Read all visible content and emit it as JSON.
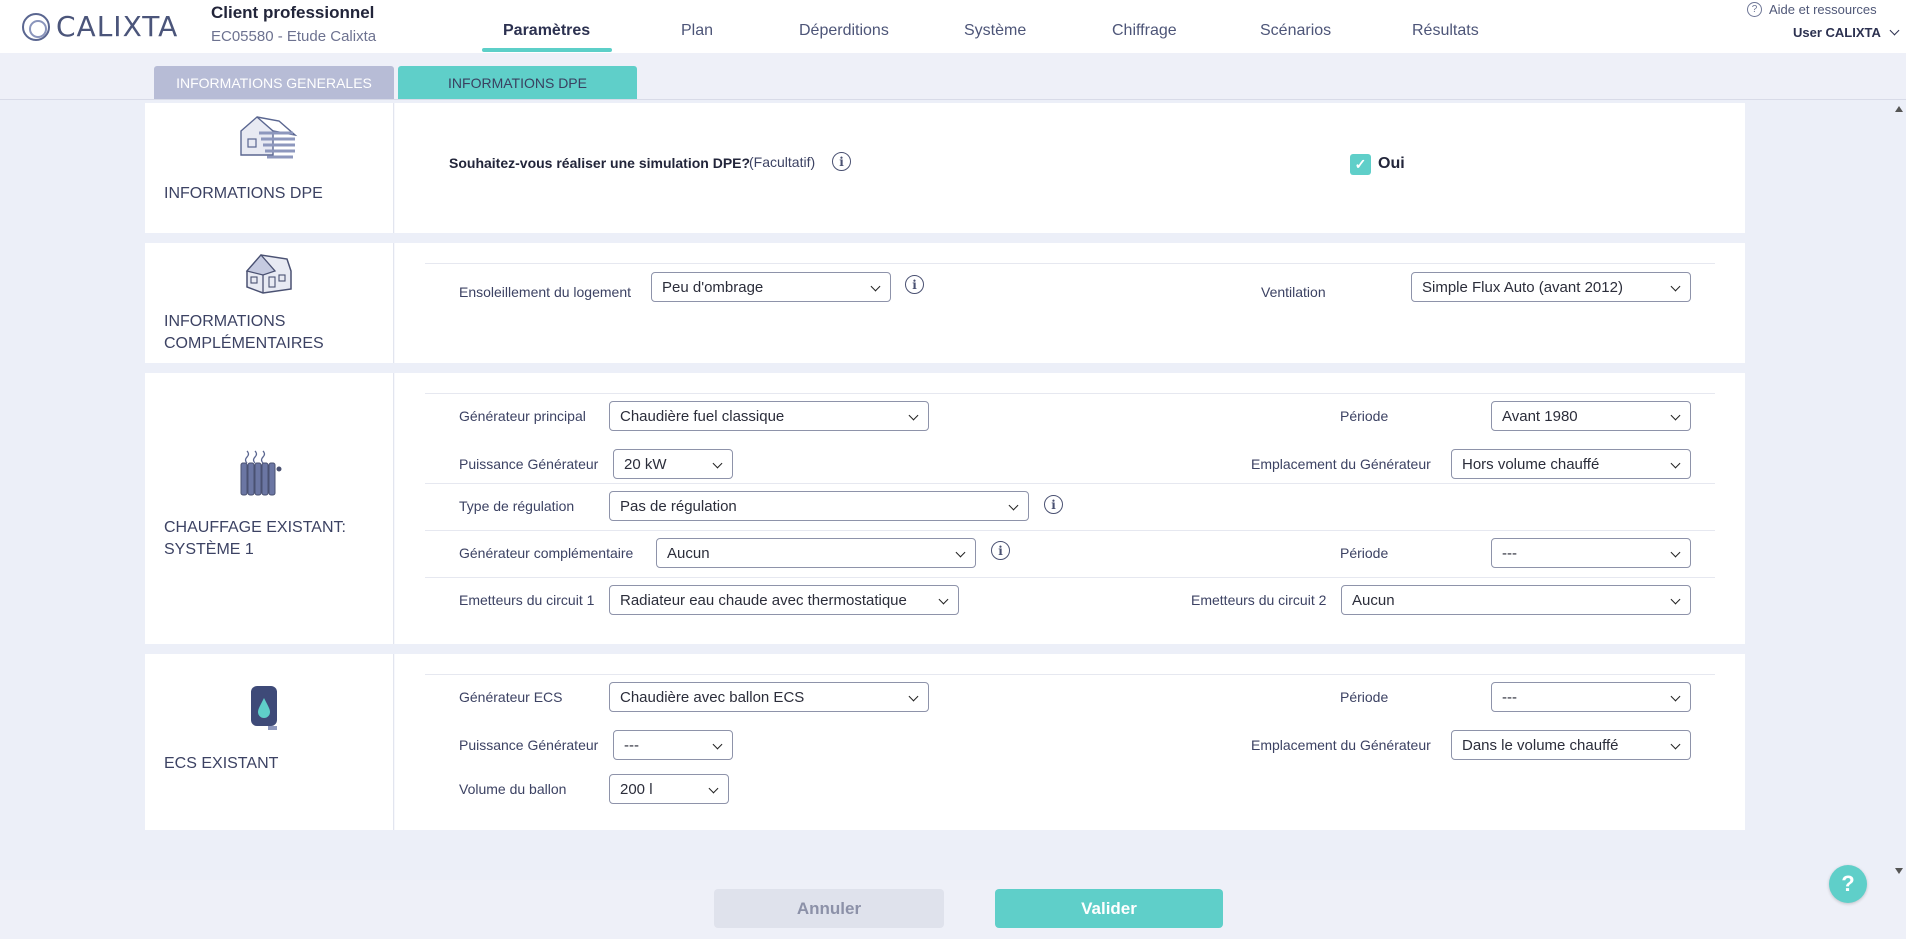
{
  "header": {
    "logo_text": "CALIXTA",
    "client_title": "Client professionnel",
    "client_sub": "EC05580 - Etude Calixta",
    "nav": [
      "Paramètres",
      "Plan",
      "Déperditions",
      "Système",
      "Chiffrage",
      "Scénarios",
      "Résultats"
    ],
    "help_label": "Aide et ressources",
    "user_label": "User CALIXTA"
  },
  "subtabs": {
    "general": "INFORMATIONS GENERALES",
    "dpe": "INFORMATIONS DPE"
  },
  "sections": {
    "dpe": {
      "title": "INFORMATIONS DPE",
      "question": "Souhaitez-vous réaliser une simulation DPE?",
      "optional": "(Facultatif)",
      "checkbox_label": "Oui",
      "checked": true
    },
    "complementaires": {
      "title_line1": "INFORMATIONS",
      "title_line2": "COMPLÉMENTAIRES",
      "ensoleillement_label": "Ensoleillement du logement",
      "ensoleillement_value": "Peu d'ombrage",
      "ventilation_label": "Ventilation",
      "ventilation_value": "Simple Flux Auto (avant 2012)"
    },
    "chauffage": {
      "title_line1": "CHAUFFAGE EXISTANT:",
      "title_line2": "SYSTÈME 1",
      "gen_principal_label": "Générateur principal",
      "gen_principal_value": "Chaudière fuel classique",
      "periode_label": "Période",
      "periode_value": "Avant 1980",
      "puissance_label": "Puissance Générateur",
      "puissance_value": "20 kW",
      "emplacement_label": "Emplacement du Générateur",
      "emplacement_value": "Hors volume chauffé",
      "regulation_label": "Type de régulation",
      "regulation_value": "Pas de régulation",
      "gen_comp_label": "Générateur complémentaire",
      "gen_comp_value": "Aucun",
      "periode2_label": "Période",
      "periode2_value": "---",
      "emetteurs1_label": "Emetteurs du circuit 1",
      "emetteurs1_value": "Radiateur eau chaude avec thermostatique",
      "emetteurs2_label": "Emetteurs du circuit 2",
      "emetteurs2_value": "Aucun"
    },
    "ecs": {
      "title": "ECS EXISTANT",
      "gen_label": "Générateur ECS",
      "gen_value": "Chaudière avec ballon ECS",
      "periode_label": "Période",
      "periode_value": "---",
      "puissance_label": "Puissance Générateur",
      "puissance_value": "---",
      "emplacement_label": "Emplacement du Générateur",
      "emplacement_value": "Dans le volume chauffé",
      "volume_label": "Volume du ballon",
      "volume_value": "200 l"
    }
  },
  "footer": {
    "cancel": "Annuler",
    "validate": "Valider",
    "help_fab": "?"
  },
  "colors": {
    "accent": "#5fcfc9",
    "tab_inactive": "#b7bcd6"
  }
}
